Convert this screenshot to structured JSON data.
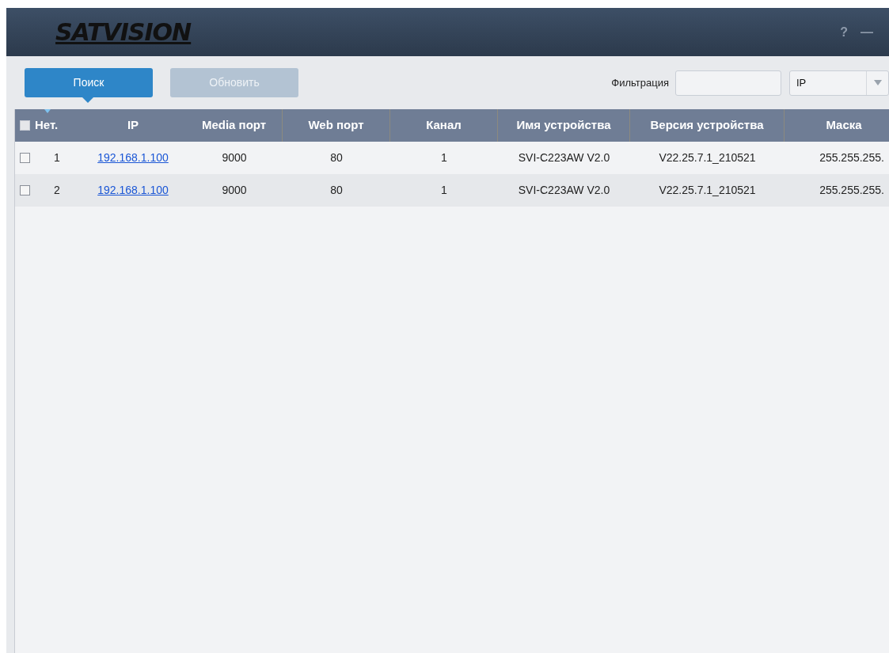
{
  "window": {
    "logo": "SATVISION",
    "controls": [
      "?",
      "—"
    ]
  },
  "toolbar": {
    "buttons": [
      {
        "label": "Поиск",
        "disabled": false
      },
      {
        "label": "Обновить",
        "disabled": true
      }
    ],
    "filter": {
      "label": "Фильтрация"
    },
    "filter_type": {
      "value": "IP"
    }
  },
  "table": {
    "select_all": {
      "checked": false
    },
    "columns": [
      "Нет.",
      "IP",
      "Media порт",
      "Web порт",
      "Канал",
      "Имя устройства",
      "Версия устройства",
      "Маска"
    ],
    "rows": [
      {
        "checked": false,
        "cells": [
          "1",
          "192.168.1.100",
          "9000",
          "80",
          "1",
          "SVI-C223AW V2.0",
          "V22.25.7.1_210521",
          "255.255.255."
        ]
      },
      {
        "checked": false,
        "cells": [
          "2",
          "192.168.1.100",
          "9000",
          "80",
          "1",
          "SVI-C223AW V2.0",
          "V22.25.7.1_210521",
          "255.255.255."
        ]
      }
    ]
  }
}
